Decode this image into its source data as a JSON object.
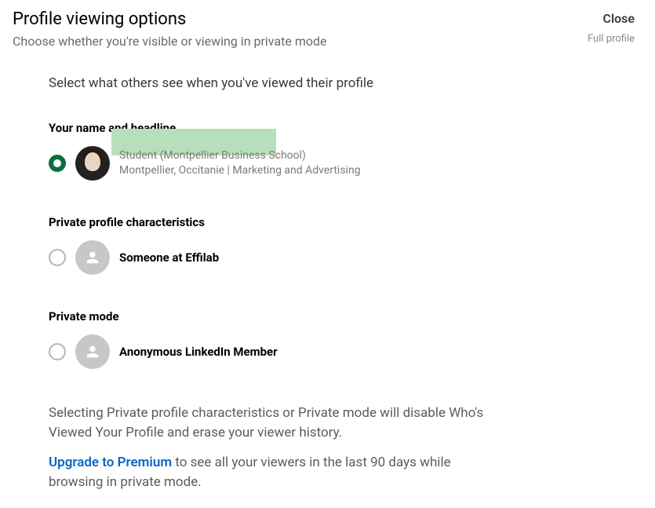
{
  "header": {
    "title": "Profile viewing options",
    "subtitle": "Choose whether you're visible or viewing in private mode",
    "close": "Close",
    "full_profile": "Full profile"
  },
  "instruction": "Select what others see when you've viewed their profile",
  "options": {
    "full": {
      "label": "Your name and headline",
      "headline": "Student (Montpellier Business School)",
      "location": "Montpellier, Occitanie | Marketing and Advertising"
    },
    "semi": {
      "label": "Private profile characteristics",
      "title": "Someone at Effilab"
    },
    "private": {
      "label": "Private mode",
      "title": "Anonymous LinkedIn Member"
    }
  },
  "disclaimer": {
    "line1": "Selecting Private profile characteristics or Private mode will disable Who's Viewed Your Profile and erase your viewer history.",
    "upgrade_link": "Upgrade to Premium",
    "line2_rest": " to see all your viewers in the last 90 days while browsing in private mode."
  }
}
